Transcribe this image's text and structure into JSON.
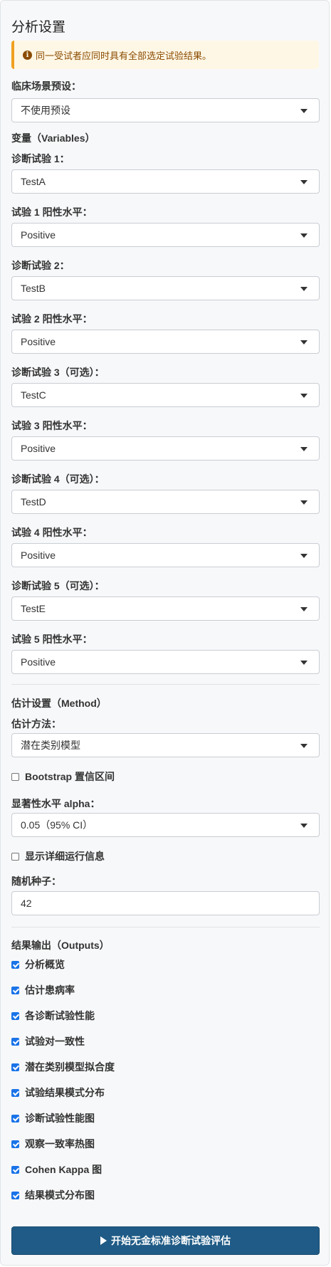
{
  "panel_title": "分析设置",
  "alert": {
    "icon": "info-icon",
    "text": "同一受试者应同时具有全部选定试验结果。"
  },
  "preset": {
    "label": "临床场景预设：",
    "value": "不使用预设"
  },
  "variables_title": "变量（Variables）",
  "tests": [
    {
      "test_label": "诊断试验 1：",
      "test_value": "TestA",
      "level_label": "试验 1 阳性水平：",
      "level_value": "Positive"
    },
    {
      "test_label": "诊断试验 2：",
      "test_value": "TestB",
      "level_label": "试验 2 阳性水平：",
      "level_value": "Positive"
    },
    {
      "test_label": "诊断试验 3（可选）：",
      "test_value": "TestC",
      "level_label": "试验 3 阳性水平：",
      "level_value": "Positive"
    },
    {
      "test_label": "诊断试验 4（可选）：",
      "test_value": "TestD",
      "level_label": "试验 4 阳性水平：",
      "level_value": "Positive"
    },
    {
      "test_label": "诊断试验 5（可选）：",
      "test_value": "TestE",
      "level_label": "试验 5 阳性水平：",
      "level_value": "Positive"
    }
  ],
  "method": {
    "title": "估计设置（Method）",
    "method_label": "估计方法：",
    "method_value": "潜在类别模型",
    "bootstrap_label": "Bootstrap 置信区间",
    "bootstrap_checked": false,
    "alpha_label": "显著性水平 alpha：",
    "alpha_value": "0.05（95% CI）",
    "verbose_label": "显示详细运行信息",
    "verbose_checked": false,
    "seed_label": "随机种子：",
    "seed_value": "42"
  },
  "outputs": {
    "title": "结果输出（Outputs）",
    "items": [
      {
        "label": "分析概览",
        "checked": true
      },
      {
        "label": "估计患病率",
        "checked": true
      },
      {
        "label": "各诊断试验性能",
        "checked": true
      },
      {
        "label": "试验对一致性",
        "checked": true
      },
      {
        "label": "潜在类别模型拟合度",
        "checked": true
      },
      {
        "label": "试验结果模式分布",
        "checked": true
      },
      {
        "label": "诊断试验性能图",
        "checked": true
      },
      {
        "label": "观察一致率热图",
        "checked": true
      },
      {
        "label": "Cohen Kappa 图",
        "checked": true
      },
      {
        "label": "结果模式分布图",
        "checked": true
      }
    ]
  },
  "run_button": {
    "icon": "play-icon",
    "label": "开始无金标准诊断试验评估",
    "color": "#1f5b86"
  }
}
